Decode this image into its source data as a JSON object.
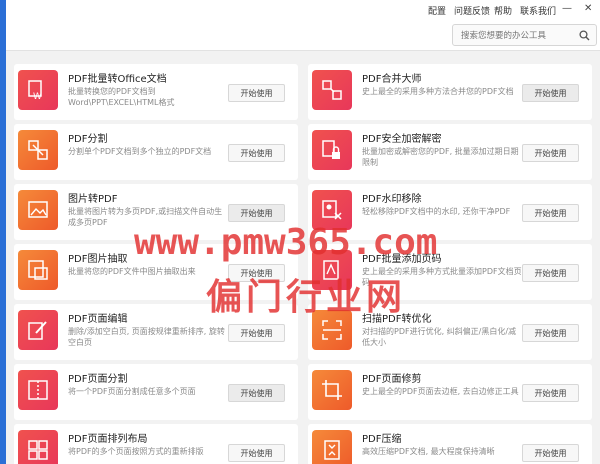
{
  "menu": {
    "items": [
      "配置",
      "问题反馈",
      "帮助",
      "联系我们"
    ],
    "minimize_icon": "minimize-icon",
    "close_icon": "close-icon"
  },
  "search": {
    "placeholder": "搜索您想要的办公工具",
    "icon": "search-icon"
  },
  "watermark": {
    "line1": "www.pmw365.com",
    "line2": "偏门行业网"
  },
  "colors": {
    "accent_blue": "#2b6fd6",
    "tile_red": "#e8375a",
    "tile_orange": "#ee5a2a"
  },
  "cards": [
    {
      "title": "PDF批量转Office文档",
      "desc": "批量转换您的PDF文档到Word\\PPT\\EXCEL\\HTML格式",
      "button": "开始使用",
      "icon": "word-convert-icon"
    },
    {
      "title": "PDF合并大师",
      "desc": "史上最全的采用多种方法合并您的PDF文档",
      "button": "开始使用",
      "icon": "merge-icon"
    },
    {
      "title": "PDF分割",
      "desc": "分割单个PDF文档到多个独立的PDF文档",
      "button": "开始使用",
      "icon": "split-icon"
    },
    {
      "title": "PDF安全加密解密",
      "desc": "批量加密或解密您的PDF, 批量添加过期日期限制",
      "button": "开始使用",
      "icon": "lock-icon"
    },
    {
      "title": "图片转PDF",
      "desc": "批量将图片转为多页PDF,或扫描文件自动生成多页PDF",
      "button": "开始使用",
      "icon": "image-icon"
    },
    {
      "title": "PDF水印移除",
      "desc": "轻松移除PDF文档中的水印, 还你干净PDF",
      "button": "开始使用",
      "icon": "watermark-remove-icon"
    },
    {
      "title": "PDF图片抽取",
      "desc": "批量将您的PDF文件中图片抽取出来",
      "button": "开始使用",
      "icon": "image-extract-icon"
    },
    {
      "title": "PDF批量添加页码",
      "desc": "史上最全的采用多种方式批量添加PDF文档页码",
      "button": "开始使用",
      "icon": "page-number-icon"
    },
    {
      "title": "PDF页面编辑",
      "desc": "删除/添加空白页, 页面按规律重新排序, 旋转空白页",
      "button": "开始使用",
      "icon": "edit-icon"
    },
    {
      "title": "扫描PDF转优化",
      "desc": "对扫描的PDF进行优化, 纠斜偏正/黑白化/减低大小",
      "button": "开始使用",
      "icon": "scan-icon"
    },
    {
      "title": "PDF页面分割",
      "desc": "将一个PDF页面分割成任意多个页面",
      "button": "开始使用",
      "icon": "page-split-icon"
    },
    {
      "title": "PDF页面修剪",
      "desc": "史上最全的PDF页面去边框, 去白边修正工具",
      "button": "开始使用",
      "icon": "crop-icon"
    },
    {
      "title": "PDF页面排列布局",
      "desc": "将PDF的多个页面按照方式的重新排版",
      "button": "开始使用",
      "icon": "layout-icon"
    },
    {
      "title": "PDF压缩",
      "desc": "高效压缩PDF文档, 最大程度保持清晰",
      "button": "开始使用",
      "icon": "compress-icon"
    }
  ]
}
